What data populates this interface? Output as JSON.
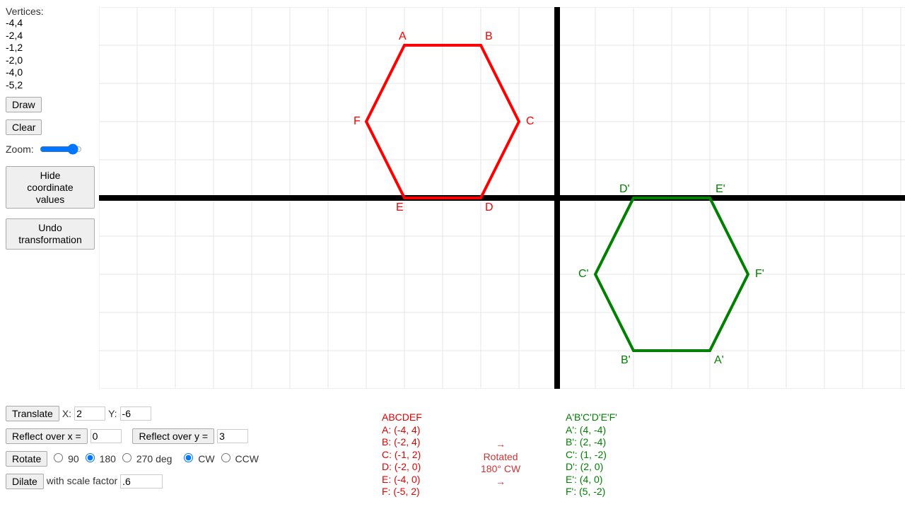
{
  "sidebar": {
    "vertices_label": "Vertices:",
    "vertices_text": "-4,4\n-2,4\n-1,2\n-2,0\n-4,0\n-5,2",
    "draw_btn": "Draw",
    "clear_btn": "Clear",
    "zoom_label": "Zoom:",
    "hide_btn": "Hide\ncoordinate\nvalues",
    "undo_btn": "Undo\ntransformation"
  },
  "controls": {
    "translate_btn": "Translate",
    "translate_x_label": "X:",
    "translate_x": "2",
    "translate_y_label": "Y:",
    "translate_y": "-6",
    "reflect_x_btn": "Reflect over x =",
    "reflect_x_val": "0",
    "reflect_y_btn": "Reflect over y =",
    "reflect_y_val": "3",
    "rotate_btn": "Rotate",
    "deg90": "90",
    "deg180": "180",
    "deg270": "270 deg",
    "cw": "CW",
    "ccw": "CCW",
    "dilate_btn": "Dilate",
    "dilate_label": "with scale factor",
    "dilate_val": ".6"
  },
  "preimage": {
    "title": "ABCDEF",
    "rows": [
      "A: (-4, 4)",
      "B: (-2, 4)",
      "C: (-1, 2)",
      "D: (-2, 0)",
      "E: (-4, 0)",
      "F: (-5, 2)"
    ]
  },
  "image": {
    "title": "A'B'C'D'E'F'",
    "rows": [
      "A': (4, -4)",
      "B': (2, -4)",
      "C': (1, -2)",
      "D': (2, 0)",
      "E': (4, 0)",
      "F': (5, -2)"
    ]
  },
  "transformation": {
    "arrow_top": "→",
    "line1": "Rotated",
    "line2": "180° CW",
    "arrow_bottom": "→"
  },
  "chart_data": {
    "type": "scatter",
    "title": "",
    "xlim": [
      -12,
      10
    ],
    "ylim": [
      -5,
      5
    ],
    "grid": true,
    "series": [
      {
        "name": "ABCDEF",
        "color": "#ff0000",
        "closed": true,
        "points": [
          {
            "label": "A",
            "x": -4,
            "y": 4
          },
          {
            "label": "B",
            "x": -2,
            "y": 4
          },
          {
            "label": "C",
            "x": -1,
            "y": 2
          },
          {
            "label": "D",
            "x": -2,
            "y": 0
          },
          {
            "label": "E",
            "x": -4,
            "y": 0
          },
          {
            "label": "F",
            "x": -5,
            "y": 2
          }
        ]
      },
      {
        "name": "A'B'C'D'E'F'",
        "color": "#008000",
        "closed": true,
        "points": [
          {
            "label": "A'",
            "x": 4,
            "y": -4
          },
          {
            "label": "B'",
            "x": 2,
            "y": -4
          },
          {
            "label": "C'",
            "x": 1,
            "y": -2
          },
          {
            "label": "D'",
            "x": 2,
            "y": 0
          },
          {
            "label": "E'",
            "x": 4,
            "y": 0
          },
          {
            "label": "F'",
            "x": 5,
            "y": -2
          }
        ]
      }
    ],
    "label_offsets": {
      "A": [
        -8,
        -8
      ],
      "B": [
        6,
        -8
      ],
      "C": [
        10,
        4
      ],
      "D": [
        6,
        18
      ],
      "E": [
        -12,
        18
      ],
      "F": [
        -18,
        4
      ],
      "A'": [
        6,
        18
      ],
      "B'": [
        -18,
        18
      ],
      "C'": [
        -24,
        4
      ],
      "D'": [
        -20,
        -8
      ],
      "E'": [
        8,
        -8
      ],
      "F'": [
        10,
        4
      ]
    }
  }
}
